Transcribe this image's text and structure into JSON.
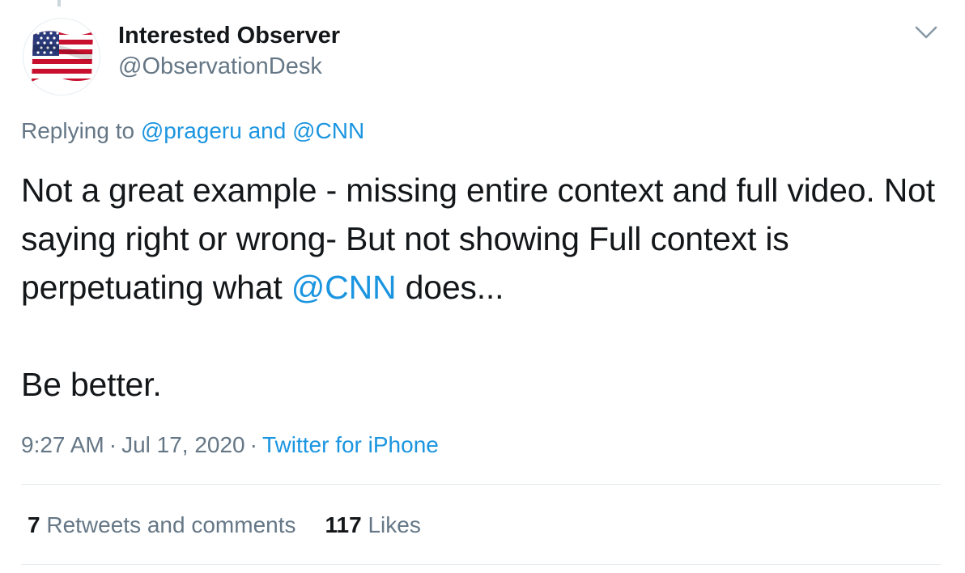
{
  "user": {
    "display_name": "Interested Observer",
    "handle": "@ObservationDesk",
    "avatar": "american-flag"
  },
  "reply": {
    "prefix": "Replying to",
    "mention1": "@prageru",
    "joiner": "and",
    "mention2": "@CNN"
  },
  "tweet": {
    "line1_a": "Not a great example - missing entire context and full video. Not saying right or wrong- But not showing Full context is perpetuating what",
    "mention": "@CNN",
    "line1_b": "does...",
    "line2": "Be better."
  },
  "meta": {
    "time": "9:27 AM",
    "separator": "·",
    "date": "Jul 17, 2020",
    "source": "Twitter for iPhone"
  },
  "stats": {
    "retweets_count": "7",
    "retweets_label": "Retweets and comments",
    "likes_count": "117",
    "likes_label": "Likes"
  },
  "colors": {
    "link": "#1b95e0",
    "secondary_text": "#657786",
    "primary_text": "#14171a",
    "divider": "#e6ecf0"
  },
  "icons": {
    "menu": "chevron-down-icon"
  }
}
